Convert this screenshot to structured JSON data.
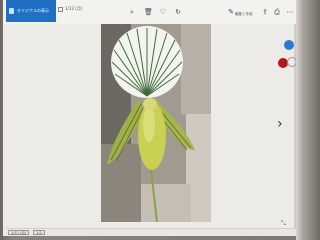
{
  "tabs": [
    {
      "label": "オリジナルの表示",
      "active": true
    },
    {
      "label": "1/12 (月)",
      "active": false
    }
  ],
  "toolbar": {
    "zoom_icon": "zoom-icon",
    "delete_icon": "delete-icon",
    "favorite_icon": "heart-icon",
    "rotate_icon": "rotate-icon",
    "edit_label": "編集と作成",
    "share_icon": "share-icon",
    "print_icon": "print-icon",
    "more_icon": "more-icon"
  },
  "taskbar": {
    "item1": "1/12 (月)",
    "item2": "1/2"
  },
  "colors": {
    "accent": "#1f6fc5",
    "blue_dot": "#2b79d4",
    "red_dot": "#b8141c"
  }
}
